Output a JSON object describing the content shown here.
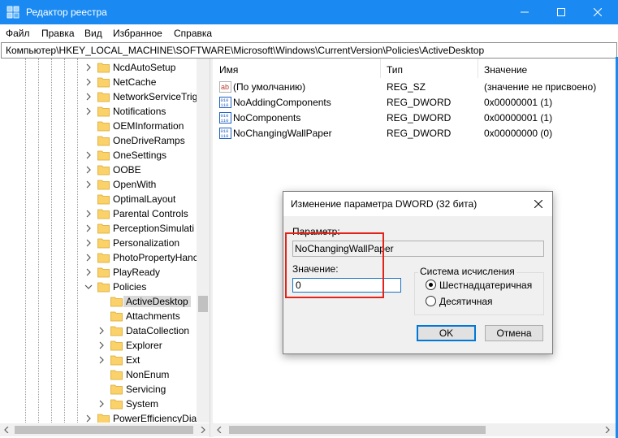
{
  "window": {
    "title": "Редактор реестра",
    "accent_color": "#1a8af2",
    "controls": [
      "minimize-icon",
      "maximize-icon",
      "close-icon"
    ]
  },
  "menu": [
    "Файл",
    "Правка",
    "Вид",
    "Избранное",
    "Справка"
  ],
  "address": "Компьютер\\HKEY_LOCAL_MACHINE\\SOFTWARE\\Microsoft\\Windows\\CurrentVersion\\Policies\\ActiveDesktop",
  "tree": {
    "items": [
      {
        "label": "NcdAutoSetup",
        "expander": "collapsed"
      },
      {
        "label": "NetCache",
        "expander": "collapsed"
      },
      {
        "label": "NetworkServiceTrig",
        "expander": "collapsed"
      },
      {
        "label": "Notifications",
        "expander": "collapsed"
      },
      {
        "label": "OEMInformation",
        "expander": "none"
      },
      {
        "label": "OneDriveRamps",
        "expander": "none"
      },
      {
        "label": "OneSettings",
        "expander": "collapsed"
      },
      {
        "label": "OOBE",
        "expander": "collapsed"
      },
      {
        "label": "OpenWith",
        "expander": "collapsed"
      },
      {
        "label": "OptimalLayout",
        "expander": "none"
      },
      {
        "label": "Parental Controls",
        "expander": "collapsed"
      },
      {
        "label": "PerceptionSimulati",
        "expander": "collapsed"
      },
      {
        "label": "Personalization",
        "expander": "collapsed"
      },
      {
        "label": "PhotoPropertyHanc",
        "expander": "collapsed"
      },
      {
        "label": "PlayReady",
        "expander": "collapsed"
      },
      {
        "label": "Policies",
        "expander": "expanded"
      },
      {
        "label": "ActiveDesktop",
        "expander": "none",
        "child": true,
        "selected": true
      },
      {
        "label": "Attachments",
        "expander": "none",
        "child": true
      },
      {
        "label": "DataCollection",
        "expander": "collapsed",
        "child": true
      },
      {
        "label": "Explorer",
        "expander": "collapsed",
        "child": true
      },
      {
        "label": "Ext",
        "expander": "collapsed",
        "child": true
      },
      {
        "label": "NonEnum",
        "expander": "none",
        "child": true
      },
      {
        "label": "Servicing",
        "expander": "none",
        "child": true
      },
      {
        "label": "System",
        "expander": "collapsed",
        "child": true
      },
      {
        "label": "PowerEfficiencyDia",
        "expander": "collapsed"
      }
    ]
  },
  "list": {
    "columns": [
      "Имя",
      "Тип",
      "Значение"
    ],
    "rows": [
      {
        "icon": "string-value-icon",
        "name": "(По умолчанию)",
        "type": "REG_SZ",
        "value": "(значение не присвоено)"
      },
      {
        "icon": "dword-value-icon",
        "name": "NoAddingComponents",
        "type": "REG_DWORD",
        "value": "0x00000001 (1)"
      },
      {
        "icon": "dword-value-icon",
        "name": "NoComponents",
        "type": "REG_DWORD",
        "value": "0x00000001 (1)"
      },
      {
        "icon": "dword-value-icon",
        "name": "NoChangingWallPaper",
        "type": "REG_DWORD",
        "value": "0x00000000 (0)"
      }
    ]
  },
  "dialog": {
    "title": "Изменение параметра DWORD (32 бита)",
    "param_label": "Параметр:",
    "param_value": "NoChangingWallPaper",
    "value_label": "Значение:",
    "value": "0",
    "radix_label": "Система исчисления",
    "radix_options": [
      "Шестнадцатеричная",
      "Десятичная"
    ],
    "radix_selected": "Шестнадцатеричная",
    "ok": "OK",
    "cancel": "Отмена",
    "highlight_color": "#e2231a"
  }
}
